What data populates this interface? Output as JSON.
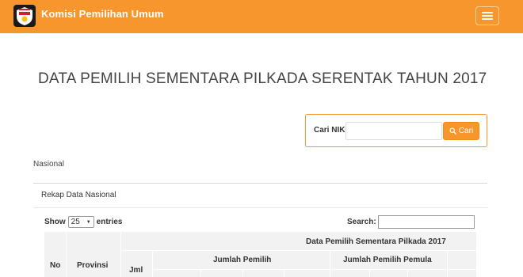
{
  "header": {
    "brand": "Komisi Pemilihan Umum",
    "logo_text": "KOMISI PEMILIHAN UMUM",
    "accent": "#f7962d"
  },
  "page": {
    "title": "DATA PEMILIH SEMENTARA PILKADA SERENTAK TAHUN 2017"
  },
  "search_panel": {
    "label": "Cari NIK",
    "value": "",
    "button_label": "Cari",
    "button_icon": "search-icon"
  },
  "breadcrumb": "Nasional",
  "section": {
    "title": "Rekap Data Nasional"
  },
  "table_controls": {
    "show_label": "Show",
    "entries_value": "25",
    "entries_label": "entries",
    "search_label": "Search:"
  },
  "table": {
    "headers": {
      "no": "No",
      "provinsi": "Provinsi",
      "group": "Data Pemilih Sementara Pilkada 2017",
      "jml": "Jml",
      "jumlah_pemilih": "Jumlah Pemilih",
      "jumlah_pemilih_pemula": "Jumlah Pemilih Pemula"
    }
  }
}
